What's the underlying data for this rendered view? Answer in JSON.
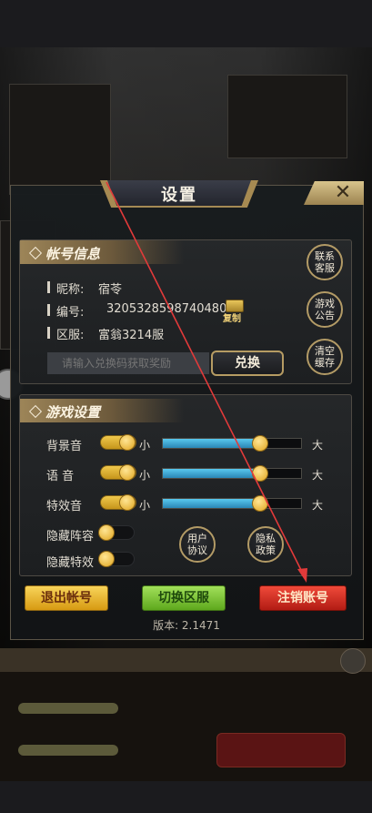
{
  "dialog": {
    "title": "设置",
    "close_label": "✕"
  },
  "account": {
    "section_title": "帐号信息",
    "nickname_label": "昵称:",
    "nickname_value": "宿苓",
    "id_label": "编号:",
    "id_value": "3205328598740480",
    "copy_label": "复制",
    "server_label": "区服:",
    "server_value": "富翁3214服",
    "side_buttons": [
      "联系\n客服",
      "游戏\n公告",
      "清空\n缓存"
    ],
    "redeem_placeholder": "请输入兑换码获取奖励",
    "redeem_button": "兑换"
  },
  "game_settings": {
    "section_title": "游戏设置",
    "sliders": [
      {
        "label": "背景音",
        "level": 0.7,
        "min_label": "小",
        "max_label": "大"
      },
      {
        "label": "语  音",
        "level": 0.7,
        "min_label": "小",
        "max_label": "大"
      },
      {
        "label": "特效音",
        "level": 0.7,
        "min_label": "小",
        "max_label": "大"
      }
    ],
    "hide_lineup_label": "隐藏阵容",
    "hide_effects_label": "隐藏特效",
    "user_agreement": "用户\n协议",
    "privacy_policy": "隐私\n政策"
  },
  "footer": {
    "logout_button": "退出帐号",
    "switch_server_button": "切换区服",
    "cancel_account_button": "注销账号",
    "version": "版本: 2.1471"
  },
  "colors": {
    "accent_gold": "#b39b66",
    "slider_fill": "#46b3e0",
    "annotation_arrow": "#e23a3a"
  }
}
